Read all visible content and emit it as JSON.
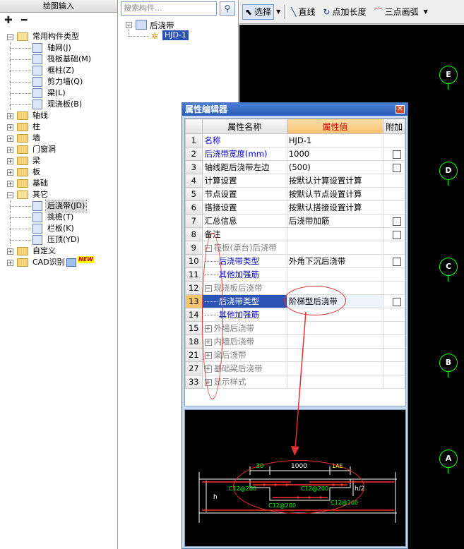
{
  "left_panel": {
    "title": "绘图输入",
    "tree": [
      {
        "label": "常用构件类型",
        "icon": "folder-open",
        "expanded": true,
        "level": 0,
        "children": [
          {
            "label": "轴网(J)",
            "icon": "grid-icon"
          },
          {
            "label": "筏板基础(M)",
            "icon": "raft-icon"
          },
          {
            "label": "框柱(Z)",
            "icon": "column-icon"
          },
          {
            "label": "剪力墙(Q)",
            "icon": "wall-icon"
          },
          {
            "label": "梁(L)",
            "icon": "beam-icon"
          },
          {
            "label": "现浇板(B)",
            "icon": "slab-icon"
          }
        ]
      },
      {
        "label": "轴线",
        "level": 0
      },
      {
        "label": "柱",
        "level": 0
      },
      {
        "label": "墙",
        "level": 0
      },
      {
        "label": "门窗洞",
        "level": 0
      },
      {
        "label": "梁",
        "level": 0
      },
      {
        "label": "板",
        "level": 0
      },
      {
        "label": "基础",
        "level": 0
      },
      {
        "label": "其它",
        "level": 0,
        "expanded": true,
        "children": [
          {
            "label": "后浇带(JD)",
            "icon": "post-cast-strip-icon",
            "selected": true
          },
          {
            "label": "挑檐(T)",
            "icon": "eave-icon"
          },
          {
            "label": "栏板(K)",
            "icon": "parapet-icon"
          },
          {
            "label": "压顶(YD)",
            "icon": "coping-icon"
          }
        ]
      },
      {
        "label": "自定义",
        "level": 0
      },
      {
        "label": "CAD识别",
        "level": 0,
        "badge": "NEW"
      }
    ]
  },
  "mid_panel": {
    "search_placeholder": "搜索构件...",
    "root_label": "后浇带",
    "child_label": "HJD-1"
  },
  "toolbar": {
    "select_label": "选择",
    "line_label": "直线",
    "add_length_label": "点加长度",
    "arc_label": "三点画弧"
  },
  "axes": [
    "E",
    "D",
    "C",
    "B",
    "A"
  ],
  "dialog": {
    "title": "属性编辑器",
    "col_name": "属性名称",
    "col_value": "属性值",
    "col_extra": "附加",
    "rows": [
      {
        "num": "1",
        "name": "名称",
        "value": "HJD-1",
        "style": "blue",
        "check": false
      },
      {
        "num": "2",
        "name": "后浇带宽度(mm)",
        "value": "1000",
        "style": "blue",
        "check": true
      },
      {
        "num": "3",
        "name": "轴线距后浇带左边",
        "value": "(500)",
        "style": "",
        "check": true
      },
      {
        "num": "4",
        "name": "计算设置",
        "value": "按默认计算设置计算",
        "style": "",
        "check": false
      },
      {
        "num": "5",
        "name": "节点设置",
        "value": "按默认节点设置计算",
        "style": "",
        "check": false
      },
      {
        "num": "6",
        "name": "搭接设置",
        "value": "按默认搭接设置计算",
        "style": "",
        "check": false
      },
      {
        "num": "7",
        "name": "汇总信息",
        "value": "后浇带加筋",
        "style": "",
        "check": true
      },
      {
        "num": "8",
        "name": "备注",
        "value": "",
        "style": "",
        "check": true
      },
      {
        "num": "9",
        "name": "筏板(承台)后浇带",
        "value": "",
        "style": "group",
        "exp": "−",
        "check": false
      },
      {
        "num": "10",
        "name": "后浇带类型",
        "value": "外角下沉后浇带",
        "style": "child-blue",
        "check": true
      },
      {
        "num": "11",
        "name": "其他加强筋",
        "value": "",
        "style": "child-blue",
        "check": false
      },
      {
        "num": "12",
        "name": "现浇板后浇带",
        "value": "",
        "style": "group",
        "exp": "−",
        "check": false
      },
      {
        "num": "13",
        "name": "后浇带类型",
        "value": "阶梯型后浇带",
        "style": "child-selected",
        "check": true
      },
      {
        "num": "14",
        "name": "其他加强筋",
        "value": "",
        "style": "child-blue",
        "check": false
      },
      {
        "num": "15",
        "name": "外墙后浇带",
        "value": "",
        "style": "group",
        "exp": "+",
        "check": false
      },
      {
        "num": "18",
        "name": "内墙后浇带",
        "value": "",
        "style": "group",
        "exp": "+",
        "check": false
      },
      {
        "num": "21",
        "name": "梁后浇带",
        "value": "",
        "style": "group",
        "exp": "+",
        "check": false
      },
      {
        "num": "27",
        "name": "基础梁后浇带",
        "value": "",
        "style": "group",
        "exp": "+",
        "check": false
      },
      {
        "num": "33",
        "name": "显示样式",
        "value": "",
        "style": "group",
        "exp": "+",
        "check": false
      }
    ]
  },
  "preview": {
    "dim_left": "30",
    "dim_mid": "1000",
    "dim_right": "1AE",
    "label_h": "h",
    "label_h2": "h/2",
    "rebar_1": "C12@200",
    "rebar_2": "C12@200",
    "rebar_3": "C12@200",
    "rebar_4": "C12@200"
  },
  "colors": {
    "accent": "#2b53b6",
    "annotation": "#e03030",
    "cad_green": "#00ff00"
  }
}
